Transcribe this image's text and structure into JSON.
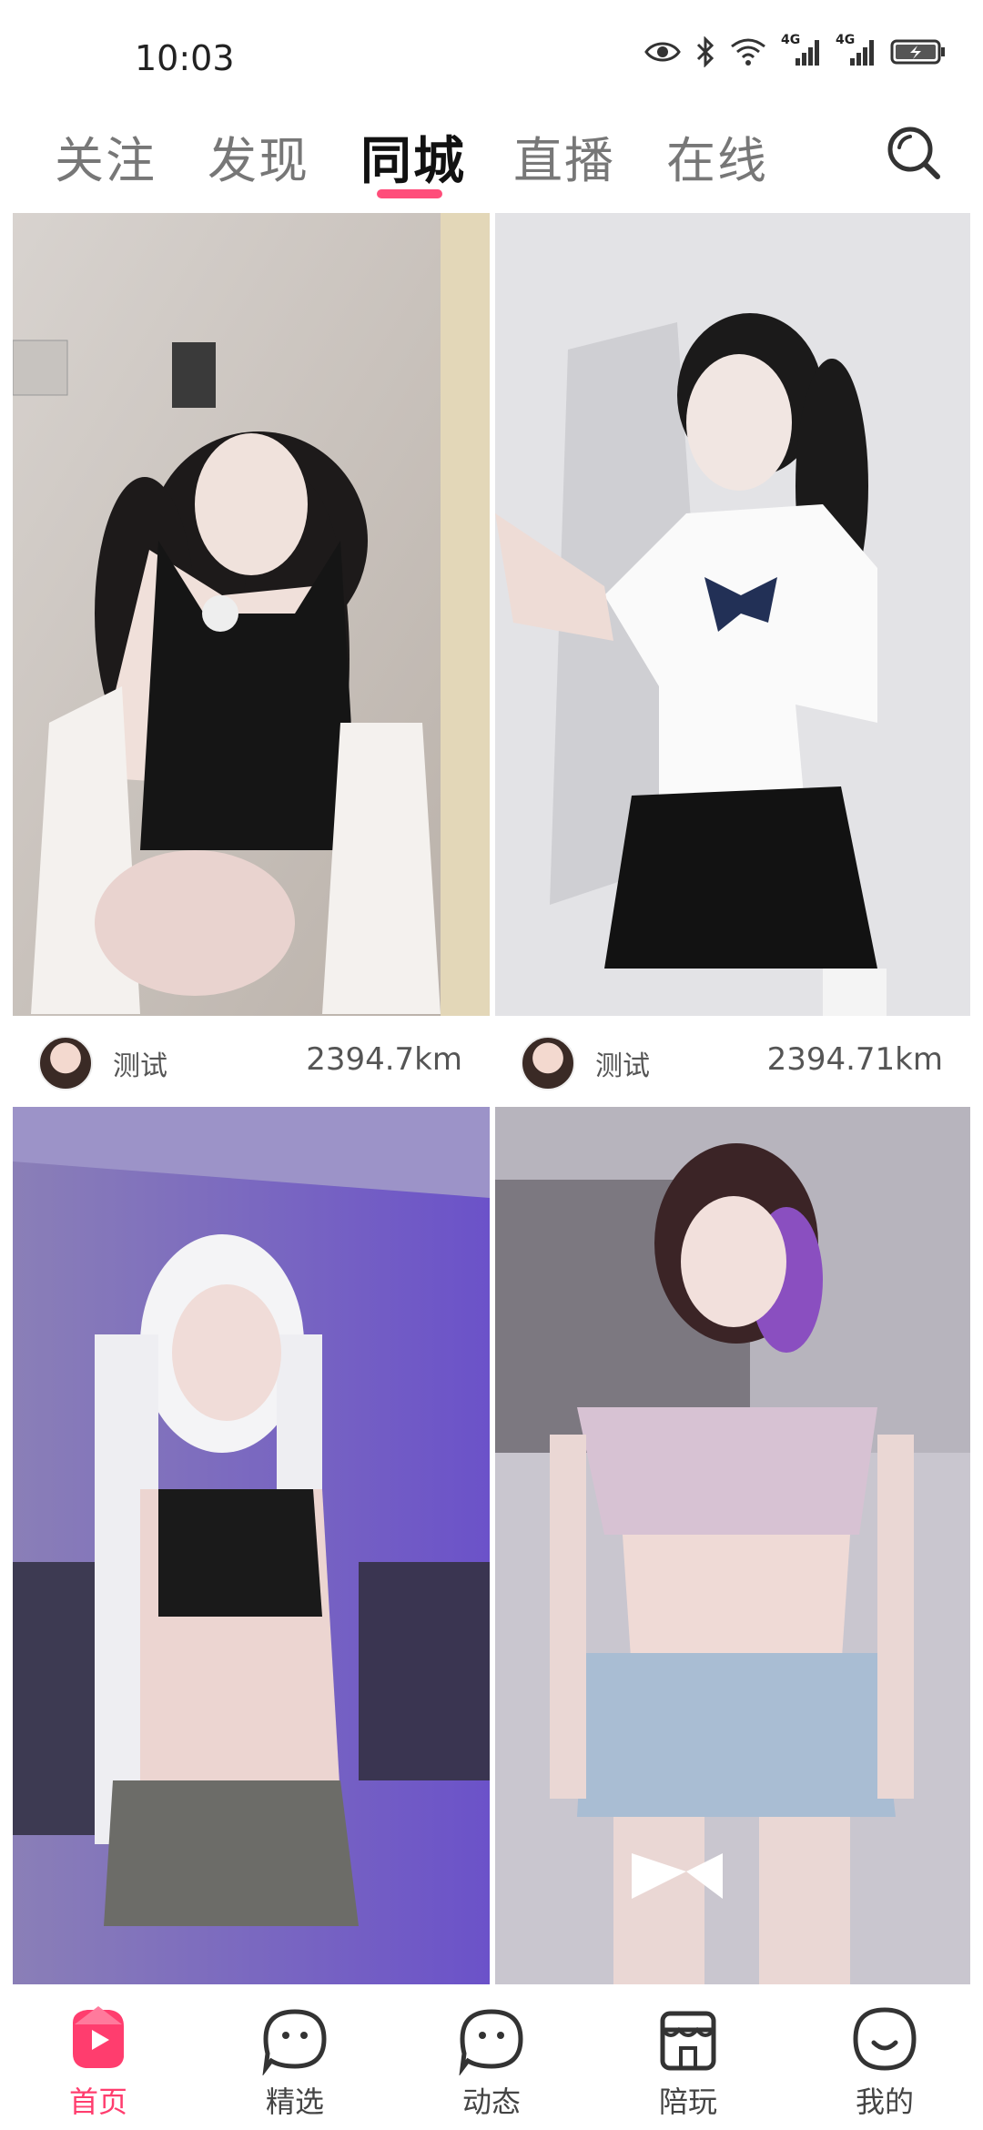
{
  "status_bar": {
    "time": "10:03",
    "icons": [
      "eye-icon",
      "bluetooth-icon",
      "wifi-icon",
      "signal-4g-icon",
      "signal-4g-icon",
      "battery-charging-icon"
    ],
    "network_label_1": "4G",
    "network_label_2": "4G"
  },
  "top_tabs": {
    "items": [
      {
        "label": "关注"
      },
      {
        "label": "发现"
      },
      {
        "label": "同城"
      },
      {
        "label": "直播"
      },
      {
        "label": "在线"
      }
    ],
    "active_index": 2,
    "search_icon": "search-icon"
  },
  "feed": {
    "cards": [
      {
        "author": "测试",
        "distance": "2394.7km"
      },
      {
        "author": "测试",
        "distance": "2394.71km"
      },
      {
        "author": "",
        "distance": ""
      },
      {
        "author": "",
        "distance": ""
      }
    ]
  },
  "bottom_nav": {
    "items": [
      {
        "label": "首页",
        "icon": "home-play-icon"
      },
      {
        "label": "精选",
        "icon": "chat-face-icon"
      },
      {
        "label": "动态",
        "icon": "chat-face-icon"
      },
      {
        "label": "陪玩",
        "icon": "shop-icon"
      },
      {
        "label": "我的",
        "icon": "smile-icon"
      }
    ],
    "active_index": 0
  },
  "colors": {
    "accent": "#ff3d6e",
    "tab_indicator": "#ff4d7a",
    "text_muted": "#777777"
  }
}
